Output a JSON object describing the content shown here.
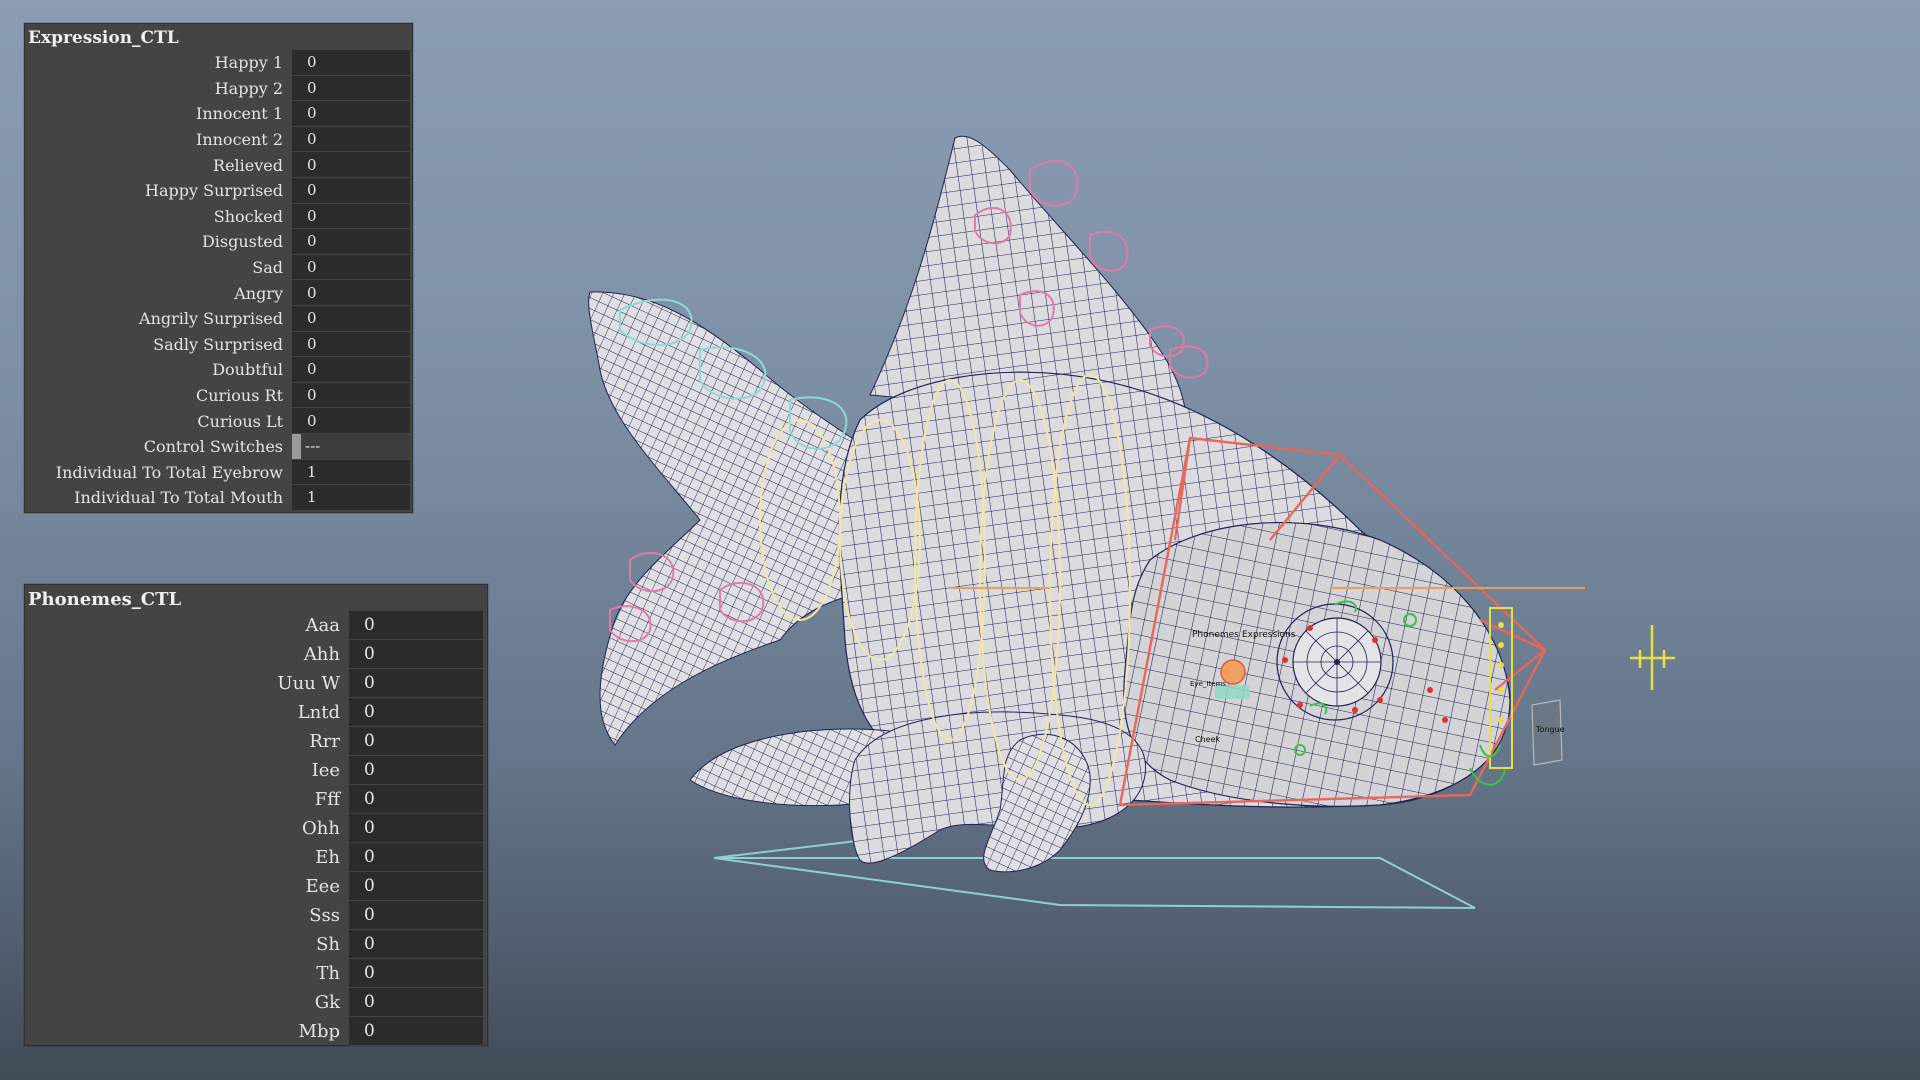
{
  "expression_ctl": {
    "title": "Expression_CTL",
    "attributes": [
      {
        "label": "Happy 1",
        "value": "0"
      },
      {
        "label": "Happy 2",
        "value": "0"
      },
      {
        "label": "Innocent 1",
        "value": "0"
      },
      {
        "label": "Innocent 2",
        "value": "0"
      },
      {
        "label": "Relieved",
        "value": "0"
      },
      {
        "label": "Happy Surprised",
        "value": "0"
      },
      {
        "label": "Shocked",
        "value": "0"
      },
      {
        "label": "Disgusted",
        "value": "0"
      },
      {
        "label": "Sad",
        "value": "0"
      },
      {
        "label": "Angry",
        "value": "0"
      },
      {
        "label": "Angrily Surprised",
        "value": "0"
      },
      {
        "label": "Sadly Surprised",
        "value": "0"
      },
      {
        "label": "Doubtful",
        "value": "0"
      },
      {
        "label": "Curious Rt",
        "value": "0"
      },
      {
        "label": "Curious Lt",
        "value": "0"
      },
      {
        "label": "Control Switches",
        "value": "---"
      },
      {
        "label": "Individual To Total Eyebrow",
        "value": "1"
      },
      {
        "label": "Individual To Total Mouth",
        "value": "1"
      }
    ]
  },
  "phonemes_ctl": {
    "title": "Phonemes_CTL",
    "attributes": [
      {
        "label": "Aaa",
        "value": "0"
      },
      {
        "label": "Ahh",
        "value": "0"
      },
      {
        "label": "Uuu W",
        "value": "0"
      },
      {
        "label": "Lntd",
        "value": "0"
      },
      {
        "label": "Rrr",
        "value": "0"
      },
      {
        "label": "Iee",
        "value": "0"
      },
      {
        "label": "Fff",
        "value": "0"
      },
      {
        "label": "Ohh",
        "value": "0"
      },
      {
        "label": "Eh",
        "value": "0"
      },
      {
        "label": "Eee",
        "value": "0"
      },
      {
        "label": "Sss",
        "value": "0"
      },
      {
        "label": "Sh",
        "value": "0"
      },
      {
        "label": "Th",
        "value": "0"
      },
      {
        "label": "Gk",
        "value": "0"
      },
      {
        "label": "Mbp",
        "value": "0"
      }
    ]
  },
  "viewport": {
    "face_labels": [
      "Phonemes",
      "Expressions",
      "Eye_Items",
      "Cheek",
      "Tongue"
    ],
    "colors": {
      "background_top": "#8a9db3",
      "background_bottom": "#414c58",
      "mesh_fill": "#d8d8dc",
      "wireframe": "#1f2350",
      "control_red": "#e8665a",
      "control_pink": "#e07aa8",
      "control_cream": "#f2e6a8",
      "control_cyan": "#8fd8d6",
      "control_green": "#3cc24a",
      "control_yellow": "#e8e040",
      "ground_plane": "#8fd0d4"
    },
    "icons": [
      "manipulator-cross-icon"
    ]
  }
}
